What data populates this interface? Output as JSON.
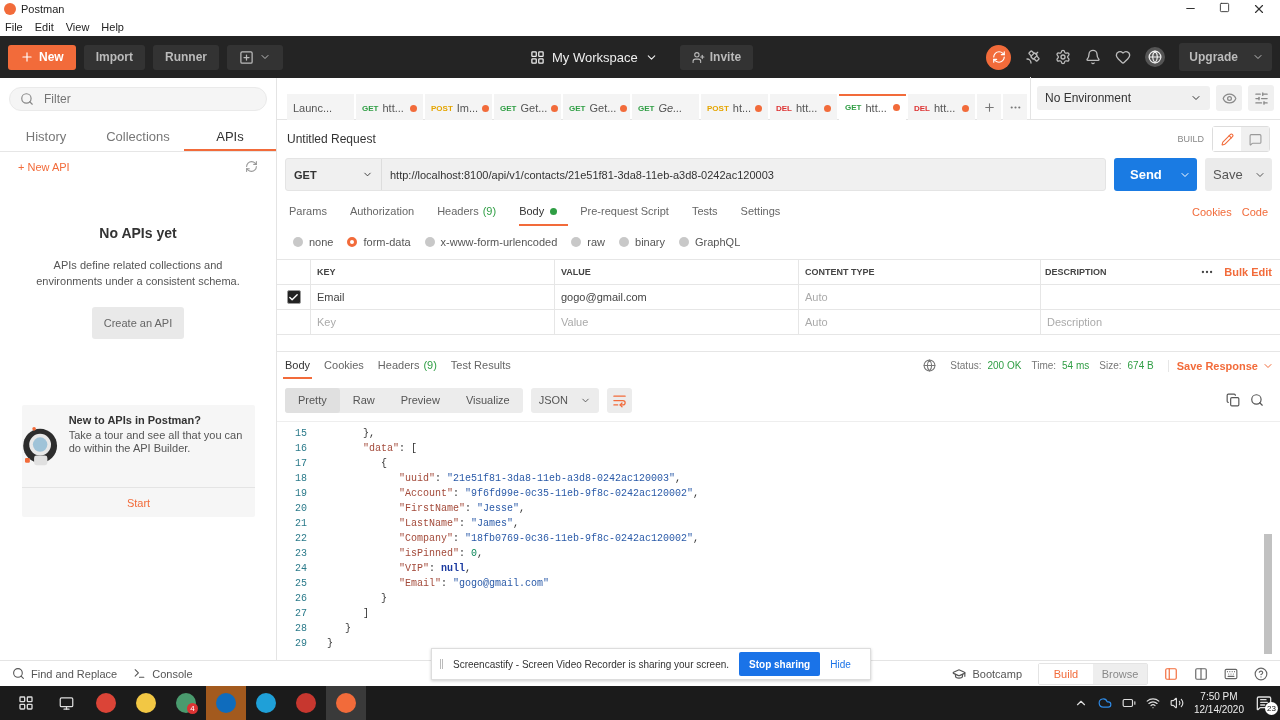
{
  "window": {
    "title": "Postman"
  },
  "menu": [
    "File",
    "Edit",
    "View",
    "Help"
  ],
  "toolbar": {
    "new": "New",
    "import": "Import",
    "runner": "Runner",
    "workspace": "My Workspace",
    "invite": "Invite",
    "upgrade": "Upgrade"
  },
  "sidebar": {
    "filter_placeholder": "Filter",
    "tabs": [
      {
        "label": "History",
        "selected": false
      },
      {
        "label": "Collections",
        "selected": false
      },
      {
        "label": "APIs",
        "selected": true
      }
    ],
    "new_api": "+ New API",
    "empty_title": "No APIs yet",
    "empty_text": "APIs define related collections and environments under a consistent schema.",
    "create_button": "Create an API",
    "promo": {
      "title": "New to APIs in Postman?",
      "text": "Take a tour and see all that you can do within the API Builder.",
      "start": "Start"
    }
  },
  "request_tabs": [
    {
      "label": "Launc...",
      "dirty": false,
      "preview": false,
      "selected": false
    },
    {
      "method": "GET",
      "label": "htt...",
      "dirty": true,
      "preview": false,
      "selected": false
    },
    {
      "method": "POST",
      "label": "Im...",
      "dirty": true,
      "preview": false,
      "selected": false
    },
    {
      "method": "GET",
      "label": "Get...",
      "dirty": true,
      "preview": false,
      "selected": false
    },
    {
      "method": "GET",
      "label": "Get...",
      "dirty": true,
      "preview": false,
      "selected": false
    },
    {
      "method": "GET",
      "label": "Ge...",
      "dirty": false,
      "preview": true,
      "selected": false
    },
    {
      "method": "POST",
      "label": "ht...",
      "dirty": true,
      "preview": false,
      "selected": false
    },
    {
      "method": "DEL",
      "label": "htt...",
      "dirty": true,
      "preview": false,
      "selected": false
    },
    {
      "method": "GET",
      "label": "htt...",
      "dirty": true,
      "preview": false,
      "selected": true
    },
    {
      "method": "DEL",
      "label": "htt...",
      "dirty": true,
      "preview": false,
      "selected": false
    }
  ],
  "environment": "No Environment",
  "request": {
    "title": "Untitled Request",
    "build": "BUILD",
    "method": "GET",
    "url": "http://localhost:8100/api/v1/contacts/21e51f81-3da8-11eb-a3d8-0242ac120003",
    "send": "Send",
    "save": "Save"
  },
  "request_sections": [
    {
      "label": "Params",
      "dot": false,
      "selected": false
    },
    {
      "label": "Authorization",
      "dot": false,
      "selected": false
    },
    {
      "label": "Headers",
      "count": "(9)",
      "dot": false,
      "selected": false
    },
    {
      "label": "Body",
      "dot": true,
      "selected": true
    },
    {
      "label": "Pre-request Script",
      "dot": false,
      "selected": false
    },
    {
      "label": "Tests",
      "dot": false,
      "selected": false
    },
    {
      "label": "Settings",
      "dot": false,
      "selected": false
    }
  ],
  "links": [
    "Cookies",
    "Code"
  ],
  "body_types": [
    {
      "label": "none",
      "selected": false
    },
    {
      "label": "form-data",
      "selected": true
    },
    {
      "label": "x-www-form-urlencoded",
      "selected": false
    },
    {
      "label": "raw",
      "selected": false
    },
    {
      "label": "binary",
      "selected": false
    },
    {
      "label": "GraphQL",
      "selected": false
    }
  ],
  "params_table": {
    "columns": [
      "KEY",
      "VALUE",
      "CONTENT TYPE",
      "DESCRIPTION"
    ],
    "bulk_edit": "Bulk Edit",
    "rows": [
      {
        "checked": true,
        "key": "Email",
        "value": "gogo@gmail.com",
        "content_type_placeholder": "Auto"
      }
    ],
    "new_row": {
      "key": "Key",
      "value": "Value",
      "content_type": "Auto",
      "description": "Description"
    }
  },
  "response": {
    "tabs": [
      {
        "label": "Body",
        "selected": true
      },
      {
        "label": "Cookies",
        "selected": false
      },
      {
        "label": "Headers",
        "count": "(9)",
        "selected": false
      },
      {
        "label": "Test Results",
        "selected": false
      }
    ],
    "status_label": "Status:",
    "status": "200 OK",
    "time_label": "Time:",
    "time": "54 ms",
    "size_label": "Size:",
    "size": "674 B",
    "save": "Save Response",
    "views": [
      {
        "label": "Pretty",
        "selected": true
      },
      {
        "label": "Raw",
        "selected": false
      },
      {
        "label": "Preview",
        "selected": false
      },
      {
        "label": "Visualize",
        "selected": false
      }
    ],
    "format": "JSON",
    "lines": [
      {
        "number": "15",
        "tokens": [
          {
            "kind": "punct",
            "text": "      },"
          }
        ]
      },
      {
        "number": "16",
        "tokens": [
          {
            "kind": "key",
            "text": "      \"data\""
          },
          {
            "kind": "punct",
            "text": ": ["
          }
        ]
      },
      {
        "number": "17",
        "tokens": [
          {
            "kind": "punct",
            "text": "         {"
          }
        ]
      },
      {
        "number": "18",
        "tokens": [
          {
            "kind": "key",
            "text": "            \"uuid\""
          },
          {
            "kind": "punct",
            "text": ": "
          },
          {
            "kind": "str",
            "text": "\"21e51f81-3da8-11eb-a3d8-0242ac120003\""
          },
          {
            "kind": "punct",
            "text": ","
          }
        ]
      },
      {
        "number": "19",
        "tokens": [
          {
            "kind": "key",
            "text": "            \"Account\""
          },
          {
            "kind": "punct",
            "text": ": "
          },
          {
            "kind": "str",
            "text": "\"9f6fd99e-0c35-11eb-9f8c-0242ac120002\""
          },
          {
            "kind": "punct",
            "text": ","
          }
        ]
      },
      {
        "number": "20",
        "tokens": [
          {
            "kind": "key",
            "text": "            \"FirstName\""
          },
          {
            "kind": "punct",
            "text": ": "
          },
          {
            "kind": "str",
            "text": "\"Jesse\""
          },
          {
            "kind": "punct",
            "text": ","
          }
        ]
      },
      {
        "number": "21",
        "tokens": [
          {
            "kind": "key",
            "text": "            \"LastName\""
          },
          {
            "kind": "punct",
            "text": ": "
          },
          {
            "kind": "str",
            "text": "\"James\""
          },
          {
            "kind": "punct",
            "text": ","
          }
        ]
      },
      {
        "number": "22",
        "tokens": [
          {
            "kind": "key",
            "text": "            \"Company\""
          },
          {
            "kind": "punct",
            "text": ": "
          },
          {
            "kind": "str",
            "text": "\"18fb0769-0c36-11eb-9f8c-0242ac120002\""
          },
          {
            "kind": "punct",
            "text": ","
          }
        ]
      },
      {
        "number": "23",
        "tokens": [
          {
            "kind": "key",
            "text": "            \"isPinned\""
          },
          {
            "kind": "punct",
            "text": ": "
          },
          {
            "kind": "num",
            "text": "0"
          },
          {
            "kind": "punct",
            "text": ","
          }
        ]
      },
      {
        "number": "24",
        "tokens": [
          {
            "kind": "key",
            "text": "            \"VIP\""
          },
          {
            "kind": "punct",
            "text": ": "
          },
          {
            "kind": "kw",
            "text": "null"
          },
          {
            "kind": "punct",
            "text": ","
          }
        ]
      },
      {
        "number": "25",
        "tokens": [
          {
            "kind": "key",
            "text": "            \"Email\""
          },
          {
            "kind": "punct",
            "text": ": "
          },
          {
            "kind": "str",
            "text": "\"gogo@gmail.com\""
          }
        ]
      },
      {
        "number": "26",
        "tokens": [
          {
            "kind": "punct",
            "text": "         }"
          }
        ]
      },
      {
        "number": "27",
        "tokens": [
          {
            "kind": "punct",
            "text": "      ]"
          }
        ]
      },
      {
        "number": "28",
        "tokens": [
          {
            "kind": "punct",
            "text": "   }"
          }
        ]
      },
      {
        "number": "29",
        "tokens": [
          {
            "kind": "punct",
            "text": "}"
          }
        ]
      }
    ]
  },
  "sharing_banner": {
    "text": "Screencastify - Screen Video Recorder is sharing your screen.",
    "stop": "Stop sharing",
    "hide": "Hide"
  },
  "status_bar": {
    "find": "Find and Replace",
    "console": "Console",
    "bootcamp": "Bootcamp",
    "modes": [
      {
        "label": "Build",
        "selected": true
      },
      {
        "label": "Browse",
        "selected": false
      }
    ]
  },
  "taskbar": {
    "badge": "4",
    "time": "7:50 PM",
    "date": "12/14/2020",
    "notifications": "23"
  }
}
